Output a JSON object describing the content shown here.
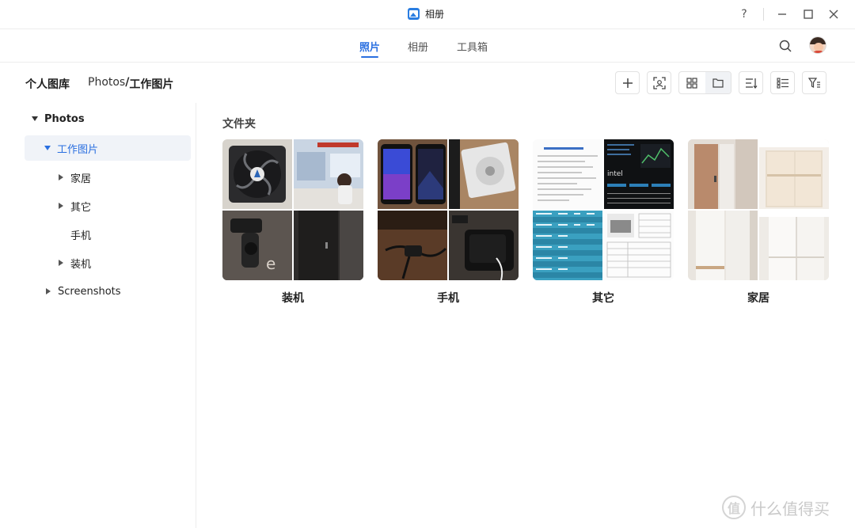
{
  "window": {
    "title": "相册",
    "help": "?",
    "minimize": "—",
    "maximize": "☐",
    "close": "✕"
  },
  "nav": {
    "tabs": [
      {
        "label": "照片",
        "active": true
      },
      {
        "label": "相册",
        "active": false
      },
      {
        "label": "工具箱",
        "active": false
      }
    ]
  },
  "header": {
    "library_title": "个人图库",
    "breadcrumb_root": "Photos",
    "breadcrumb_sep": "/",
    "breadcrumb_current": "工作图片"
  },
  "toolbar": {
    "icons": [
      "plus-icon",
      "face-scan-icon",
      "grid-view-icon",
      "folder-view-icon",
      "sort-icon",
      "list-icon",
      "filter-icon"
    ],
    "active_view": "folder-view"
  },
  "sidebar": {
    "tree": [
      {
        "label": "Photos",
        "state": "expanded"
      },
      {
        "label": "工作图片",
        "state": "expanded",
        "selected": true
      },
      {
        "label": "家居",
        "state": "collapsed"
      },
      {
        "label": "其它",
        "state": "collapsed"
      },
      {
        "label": "手机",
        "state": "leaf"
      },
      {
        "label": "装机",
        "state": "collapsed"
      },
      {
        "label": "Screenshots",
        "state": "collapsed"
      }
    ]
  },
  "main": {
    "section_title": "文件夹",
    "folders": [
      {
        "label": "装机"
      },
      {
        "label": "手机"
      },
      {
        "label": "其它"
      },
      {
        "label": "家居"
      }
    ]
  },
  "colors": {
    "accent": "#2a6fe0",
    "selected_bg": "#f0f3f8",
    "border": "#ededed"
  },
  "watermark": {
    "badge": "值",
    "text": "什么值得买"
  }
}
